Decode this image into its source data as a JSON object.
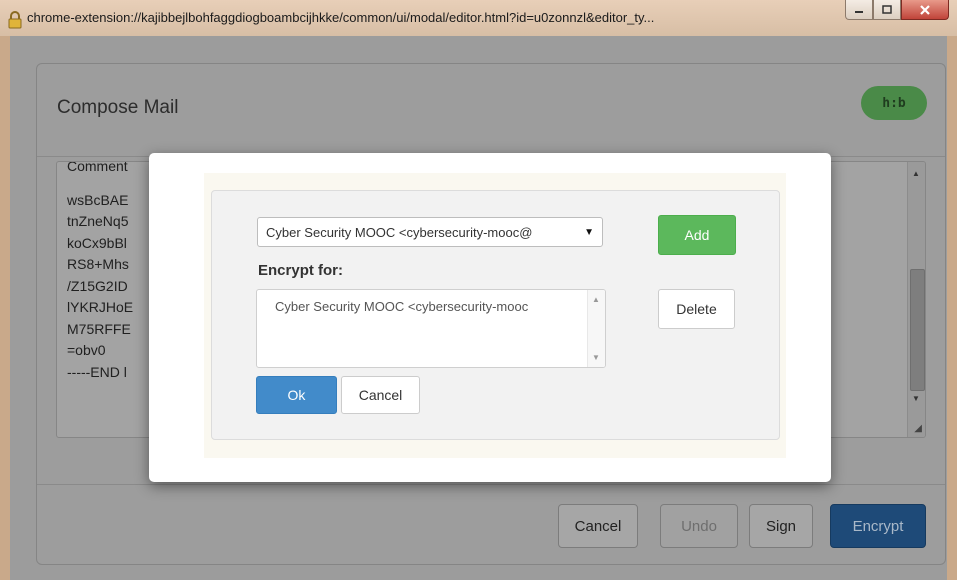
{
  "window": {
    "url": "chrome-extension://kajibbejlbohfaggdiogboambcijhkke/common/ui/modal/editor.html?id=u0zonnzl&editor_ty..."
  },
  "compose": {
    "title": "Compose Mail",
    "badge": "h:b",
    "header_fragment": "Comment",
    "editor_lines": [
      "wsBcBAE",
      "tnZneNq5",
      "koCx9bBl",
      "RS8+Mhs",
      "/Z15G2ID",
      "lYKRJHoE",
      "M75RFFE",
      "=obv0",
      "-----END l"
    ],
    "buttons": {
      "cancel": "Cancel",
      "undo": "Undo",
      "sign": "Sign",
      "encrypt": "Encrypt"
    }
  },
  "modal": {
    "recipient_select_value": "Cyber Security MOOC <cybersecurity-mooc@",
    "add_label": "Add",
    "encrypt_for_label": "Encrypt for:",
    "recipients": [
      "Cyber Security MOOC <cybersecurity-mooc"
    ],
    "delete_label": "Delete",
    "ok_label": "Ok",
    "cancel_label": "Cancel"
  },
  "colors": {
    "ok_primary": "#428bca",
    "add_success": "#5cb85c",
    "encrypt_dimmed": "#1e4a78",
    "badge_dimmed": "#4a8a48"
  },
  "icons": {
    "lock": "lock-icon",
    "minimize": "minimize-icon",
    "maximize": "maximize-icon",
    "close": "close-icon",
    "dropdown": "chevron-down-icon",
    "resize": "resize-grip-icon"
  }
}
